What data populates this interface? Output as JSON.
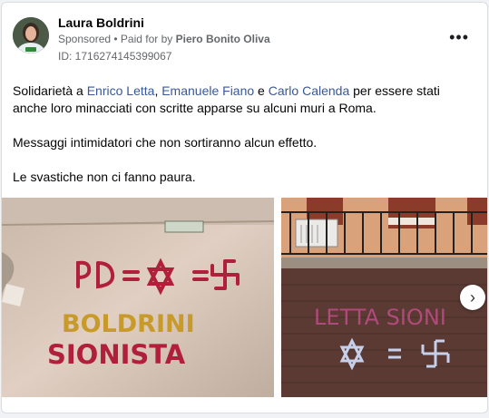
{
  "post": {
    "author": "Laura Boldrini",
    "sponsored_label": "Sponsored",
    "separator": " • ",
    "paid_for_prefix": "Paid for by ",
    "paid_for_name": "Piero Bonito Oliva",
    "id_line": "ID: 1716274145399067",
    "more_label": "•••",
    "text": {
      "p1_start": "Solidarietà a ",
      "link1": "Enrico Letta",
      "comma": ", ",
      "link2": "Emanuele Fiano",
      "and": " e ",
      "link3": "Carlo Calenda",
      "p1_end": " per essere stati anche loro minacciati con scritte apparse su alcuni muri a Roma.",
      "p2": "Messaggi intimidatori che non sortiranno alcun effetto.",
      "p3": "Le svastiche non ci fanno paura."
    },
    "next_label": "›"
  },
  "photo1": {
    "graffiti_line1": "PD =",
    "graffiti_line2": "BOLDRINI",
    "graffiti_line3": "SIONISTA"
  },
  "photo2": {
    "graffiti_line1": "LETTA  SIONI"
  },
  "colors": {
    "link": "#385898",
    "muted": "#65676b",
    "graffiti_red": "#b0203a",
    "graffiti_yellow": "#c89a2a"
  }
}
